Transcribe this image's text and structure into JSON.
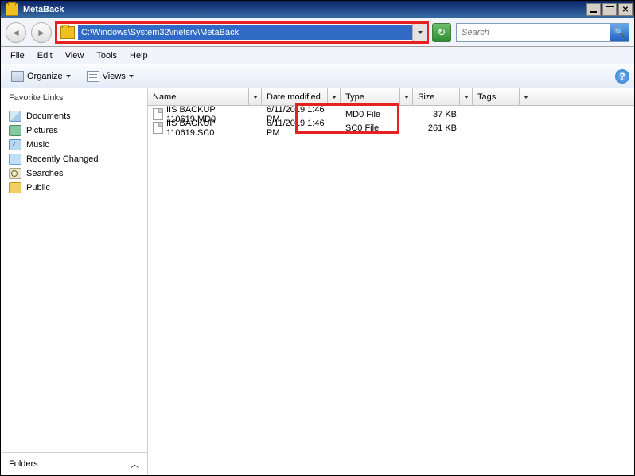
{
  "window": {
    "title": "MetaBack"
  },
  "nav": {
    "path": "C:\\Windows\\System32\\inetsrv\\MetaBack",
    "search_placeholder": "Search"
  },
  "menu": {
    "items": [
      "File",
      "Edit",
      "View",
      "Tools",
      "Help"
    ]
  },
  "toolbar": {
    "organize": "Organize",
    "views": "Views"
  },
  "sidebar": {
    "favorites_header": "Favorite Links",
    "items": [
      {
        "label": "Documents",
        "icon": "doc"
      },
      {
        "label": "Pictures",
        "icon": "pic"
      },
      {
        "label": "Music",
        "icon": "mus"
      },
      {
        "label": "Recently Changed",
        "icon": "rec"
      },
      {
        "label": "Searches",
        "icon": "sea"
      },
      {
        "label": "Public",
        "icon": "pub"
      }
    ],
    "folders": "Folders"
  },
  "columns": [
    "Name",
    "Date modified",
    "Type",
    "Size",
    "Tags"
  ],
  "files": [
    {
      "name": "IIS BACKUP 110619.MD0",
      "date": "6/11/2019 1:46 PM",
      "type": "MD0 File",
      "size": "37 KB"
    },
    {
      "name": "IIS BACKUP 110619.SC0",
      "date": "6/11/2019 1:46 PM",
      "type": "SC0 File",
      "size": "261 KB"
    }
  ]
}
